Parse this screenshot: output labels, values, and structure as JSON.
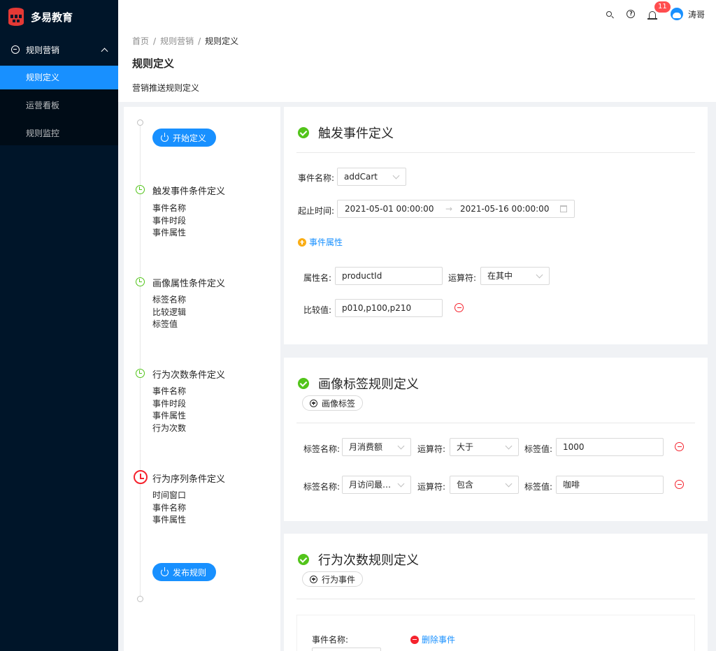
{
  "sidebar": {
    "logo_text": "多易教育",
    "submenu_title": "规则营销",
    "items": [
      {
        "label": "规则定义"
      },
      {
        "label": "运营看板"
      },
      {
        "label": "规则监控"
      }
    ]
  },
  "header": {
    "notification_count": "11",
    "user_name": "涛哥",
    "help_glyph": "?"
  },
  "breadcrumb": [
    "首页",
    "规则营销",
    "规则定义"
  ],
  "breadcrumb_sep": "/",
  "page": {
    "title": "规则定义",
    "description": "营销推送规则定义"
  },
  "steps": {
    "start_button": "开始定义",
    "publish_button": "发布规则",
    "groups": [
      {
        "title": "触发事件条件定义",
        "items": [
          "事件名称",
          "事件时段",
          "事件属性"
        ]
      },
      {
        "title": "画像属性条件定义",
        "items": [
          "标签名称",
          "比较逻辑",
          "标签值"
        ]
      },
      {
        "title": "行为次数条件定义",
        "items": [
          "事件名称",
          "事件时段",
          "事件属性",
          "行为次数"
        ]
      },
      {
        "title": "行为序列条件定义",
        "items": [
          "时间窗口",
          "事件名称",
          "事件属性"
        ]
      }
    ]
  },
  "trigger_card": {
    "title": "触发事件定义",
    "event_name_label": "事件名称:",
    "event_name_value": "addCart",
    "time_label": "起止时间:",
    "start_time": "2021-05-01 00:00:00",
    "range_arrow": "→",
    "end_time": "2021-05-16 00:00:00",
    "add_attr_link": "事件属性",
    "attr_name_label": "属性名:",
    "attr_name_value": "productId",
    "operator_label": "运算符:",
    "operator_value": "在其中",
    "compare_label": "比较值:",
    "compare_value": "p010,p100,p210"
  },
  "profile_card": {
    "title": "画像标签规则定义",
    "add_button": "画像标签",
    "rows": [
      {
        "tag_label": "标签名称:",
        "tag_name": "月消费额",
        "op_label": "运算符:",
        "op": "大于",
        "value_label": "标签值:",
        "value": "1000"
      },
      {
        "tag_label": "标签名称:",
        "tag_name": "月访问最…",
        "op_label": "运算符:",
        "op": "包含",
        "value_label": "标签值:",
        "value": "咖啡"
      }
    ]
  },
  "count_card": {
    "title": "行为次数规则定义",
    "add_button": "行为事件",
    "event_name_label": "事件名称:",
    "delete_link": "删除事件"
  },
  "colors": {
    "sidebar_bg": "#001529",
    "primary": "#1890ff",
    "success": "#52c41a",
    "danger": "#f5222d",
    "warning": "#faad14"
  }
}
